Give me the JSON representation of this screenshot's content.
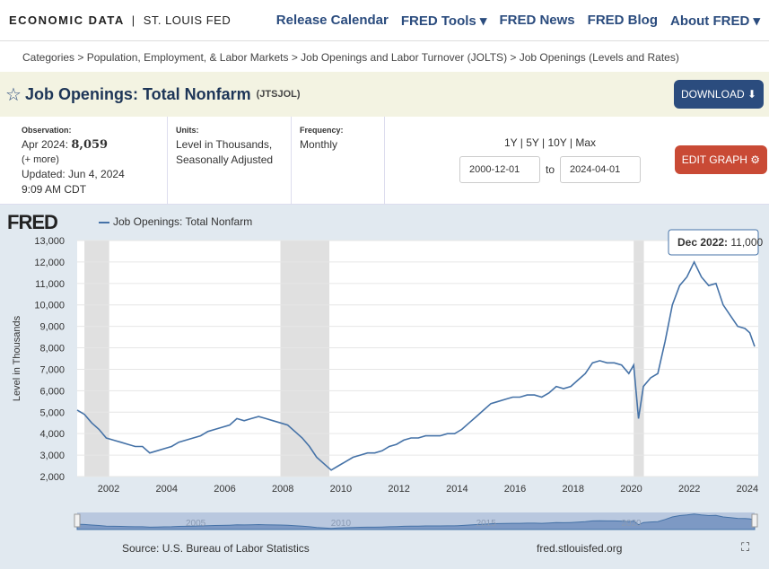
{
  "header": {
    "brand": "ECONOMIC DATA",
    "separator": "|",
    "org": "ST. LOUIS FED",
    "nav": [
      "Release Calendar",
      "FRED Tools ▾",
      "FRED News",
      "FRED Blog",
      "About FRED ▾"
    ]
  },
  "breadcrumb": "Categories > Population, Employment, & Labor Markets > Job Openings and Labor Turnover (JOLTS) > Job Openings (Levels and Rates)",
  "series": {
    "title": "Job Openings: Total Nonfarm",
    "id": "(JTSJOL)",
    "download": "DOWNLOAD ⬇"
  },
  "meta": {
    "obs_label": "Observation:",
    "obs_date": "Apr 2024:",
    "obs_value": "8,059",
    "more": "(+ more)",
    "updated": "Updated: Jun 4, 2024",
    "time": "9:09 AM CDT",
    "units_label": "Units:",
    "units1": "Level in Thousands,",
    "units2": "Seasonally Adjusted",
    "freq_label": "Frequency:",
    "freq": "Monthly"
  },
  "range": {
    "presets": "1Y | 5Y | 10Y | Max",
    "start": "2000-12-01",
    "to": "to",
    "end": "2024-04-01",
    "edit": "EDIT GRAPH ⚙"
  },
  "chart": {
    "logo": "FRED",
    "legend": "Job Openings: Total Nonfarm",
    "tooltip_label": "Dec 2022:",
    "tooltip_value": "11,000",
    "source": "Source: U.S. Bureau of Labor Statistics",
    "url": "fred.stlouisfed.org",
    "fullscreen": "⛶",
    "navigator_ticks": [
      "2005",
      "2010",
      "2015",
      "2020"
    ]
  },
  "colors": {
    "line": "#4572a7",
    "recession": "#e0e0e0",
    "nav": "#2b4c7e",
    "edit": "#c94a35"
  },
  "chart_data": {
    "type": "line",
    "ylabel": "Level in Thousands",
    "ylim": [
      2000,
      13000
    ],
    "yticks": [
      2000,
      3000,
      4000,
      5000,
      6000,
      7000,
      8000,
      9000,
      10000,
      11000,
      12000,
      13000
    ],
    "ytick_labels": [
      "2,000",
      "3,000",
      "4,000",
      "5,000",
      "6,000",
      "7,000",
      "8,000",
      "9,000",
      "10,000",
      "11,000",
      "12,000",
      "13,000"
    ],
    "xticks": [
      "2002",
      "2004",
      "2006",
      "2008",
      "2010",
      "2012",
      "2014",
      "2016",
      "2018",
      "2020",
      "2022",
      "2024"
    ],
    "recessions": [
      [
        "2001-03",
        "2001-11"
      ],
      [
        "2007-12",
        "2009-06"
      ],
      [
        "2020-02",
        "2020-04"
      ]
    ],
    "series": [
      {
        "dates": [
          "2000-12",
          "2001-03",
          "2001-06",
          "2001-09",
          "2001-12",
          "2002-03",
          "2002-06",
          "2002-09",
          "2002-12",
          "2003-03",
          "2003-06",
          "2003-09",
          "2003-12",
          "2004-03",
          "2004-06",
          "2004-09",
          "2004-12",
          "2005-03",
          "2005-06",
          "2005-09",
          "2005-12",
          "2006-03",
          "2006-06",
          "2006-09",
          "2006-12",
          "2007-03",
          "2007-06",
          "2007-09",
          "2007-12",
          "2008-03",
          "2008-06",
          "2008-09",
          "2008-12",
          "2009-03",
          "2009-06",
          "2009-09",
          "2009-12",
          "2010-03",
          "2010-06",
          "2010-09",
          "2010-12",
          "2011-03",
          "2011-06",
          "2011-09",
          "2011-12",
          "2012-03",
          "2012-06",
          "2012-09",
          "2012-12",
          "2013-03",
          "2013-06",
          "2013-09",
          "2013-12",
          "2014-03",
          "2014-06",
          "2014-09",
          "2014-12",
          "2015-03",
          "2015-06",
          "2015-09",
          "2015-12",
          "2016-03",
          "2016-06",
          "2016-09",
          "2016-12",
          "2017-03",
          "2017-06",
          "2017-09",
          "2017-12",
          "2018-03",
          "2018-06",
          "2018-09",
          "2018-12",
          "2019-03",
          "2019-06",
          "2019-09",
          "2019-12",
          "2020-02",
          "2020-04",
          "2020-06",
          "2020-09",
          "2020-12",
          "2021-03",
          "2021-06",
          "2021-09",
          "2021-12",
          "2022-03",
          "2022-06",
          "2022-09",
          "2022-12",
          "2023-03",
          "2023-06",
          "2023-09",
          "2023-12",
          "2024-02",
          "2024-04"
        ],
        "values": [
          5100,
          4900,
          4500,
          4200,
          3800,
          3700,
          3600,
          3500,
          3400,
          3400,
          3100,
          3200,
          3300,
          3400,
          3600,
          3700,
          3800,
          3900,
          4100,
          4200,
          4300,
          4400,
          4700,
          4600,
          4700,
          4800,
          4700,
          4600,
          4500,
          4400,
          4100,
          3800,
          3400,
          2900,
          2600,
          2300,
          2500,
          2700,
          2900,
          3000,
          3100,
          3100,
          3200,
          3400,
          3500,
          3700,
          3800,
          3800,
          3900,
          3900,
          3900,
          4000,
          4000,
          4200,
          4500,
          4800,
          5100,
          5400,
          5500,
          5600,
          5700,
          5700,
          5800,
          5800,
          5700,
          5900,
          6200,
          6100,
          6200,
          6500,
          6800,
          7300,
          7400,
          7300,
          7300,
          7200,
          6800,
          7200,
          4700,
          6200,
          6600,
          6800,
          8300,
          10000,
          10900,
          11300,
          12000,
          11300,
          10900,
          11000,
          10000,
          9500,
          9000,
          8900,
          8700,
          8059
        ]
      }
    ]
  }
}
